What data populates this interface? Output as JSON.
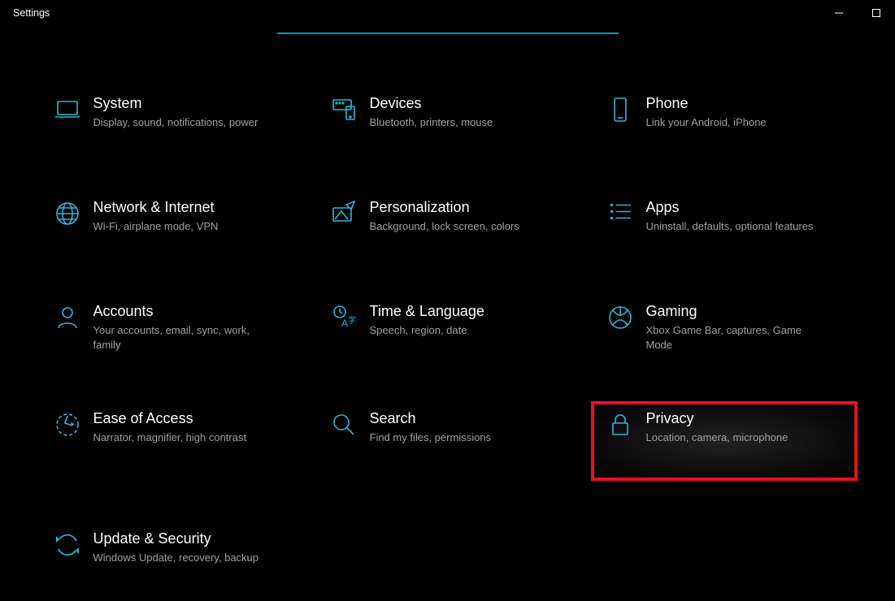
{
  "window": {
    "title": "Settings"
  },
  "accent_color": "#2cb6d9",
  "highlight_color": "#e81123",
  "categories": [
    {
      "id": "system",
      "icon": "laptop-icon",
      "title": "System",
      "desc": "Display, sound, notifications, power"
    },
    {
      "id": "devices",
      "icon": "devices-icon",
      "title": "Devices",
      "desc": "Bluetooth, printers, mouse"
    },
    {
      "id": "phone",
      "icon": "phone-icon",
      "title": "Phone",
      "desc": "Link your Android, iPhone"
    },
    {
      "id": "network",
      "icon": "globe-icon",
      "title": "Network & Internet",
      "desc": "Wi-Fi, airplane mode, VPN"
    },
    {
      "id": "personalization",
      "icon": "paint-icon",
      "title": "Personalization",
      "desc": "Background, lock screen, colors"
    },
    {
      "id": "apps",
      "icon": "apps-icon",
      "title": "Apps",
      "desc": "Uninstall, defaults, optional features"
    },
    {
      "id": "accounts",
      "icon": "person-icon",
      "title": "Accounts",
      "desc": "Your accounts, email, sync, work, family"
    },
    {
      "id": "time-language",
      "icon": "language-icon",
      "title": "Time & Language",
      "desc": "Speech, region, date"
    },
    {
      "id": "gaming",
      "icon": "gaming-icon",
      "title": "Gaming",
      "desc": "Xbox Game Bar, captures, Game Mode"
    },
    {
      "id": "ease-of-access",
      "icon": "ease-icon",
      "title": "Ease of Access",
      "desc": "Narrator, magnifier, high contrast"
    },
    {
      "id": "search",
      "icon": "search-icon",
      "title": "Search",
      "desc": "Find my files, permissions"
    },
    {
      "id": "privacy",
      "icon": "lock-icon",
      "title": "Privacy",
      "desc": "Location, camera, microphone",
      "highlighted": true
    },
    {
      "id": "update-security",
      "icon": "update-icon",
      "title": "Update & Security",
      "desc": "Windows Update, recovery, backup"
    }
  ]
}
